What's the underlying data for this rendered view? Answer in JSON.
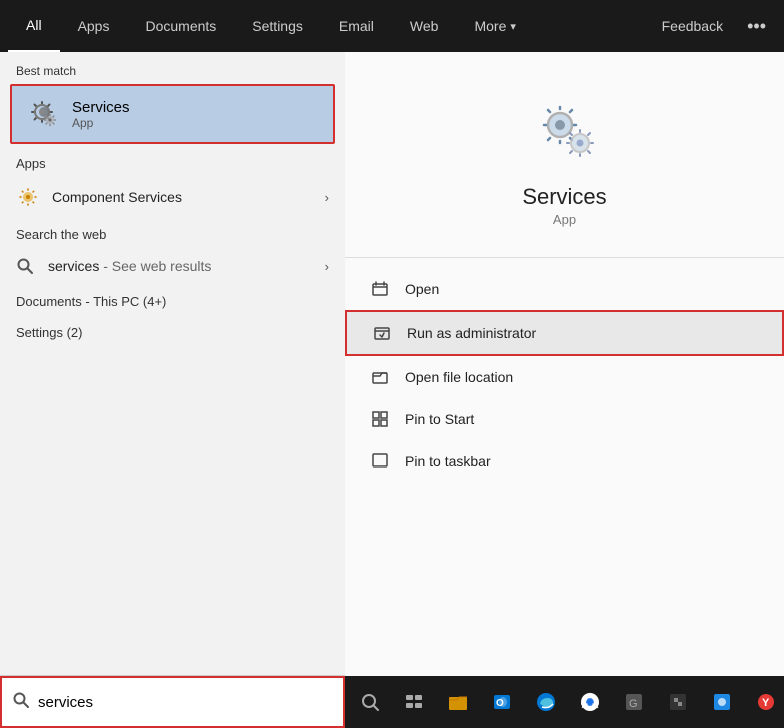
{
  "nav": {
    "tabs": [
      {
        "id": "all",
        "label": "All",
        "active": true
      },
      {
        "id": "apps",
        "label": "Apps",
        "active": false
      },
      {
        "id": "documents",
        "label": "Documents",
        "active": false
      },
      {
        "id": "settings",
        "label": "Settings",
        "active": false
      },
      {
        "id": "email",
        "label": "Email",
        "active": false
      },
      {
        "id": "web",
        "label": "Web",
        "active": false
      },
      {
        "id": "more",
        "label": "More",
        "active": false
      }
    ],
    "feedback_label": "Feedback",
    "more_icon": "•••"
  },
  "left": {
    "best_match_label": "Best match",
    "best_match_title": "Services",
    "best_match_sub": "App",
    "apps_label": "Apps",
    "apps_items": [
      {
        "label": "Component Services",
        "has_arrow": true
      }
    ],
    "web_label": "Search the web",
    "web_item_text": "services",
    "web_item_sub": " - See web results",
    "docs_label": "Documents - This PC (4+)",
    "settings_label": "Settings (2)"
  },
  "right": {
    "app_name": "Services",
    "app_type": "App",
    "actions": [
      {
        "label": "Open",
        "id": "open"
      },
      {
        "label": "Run as administrator",
        "id": "run-admin",
        "highlighted": true
      },
      {
        "label": "Open file location",
        "id": "open-file"
      },
      {
        "label": "Pin to Start",
        "id": "pin-start"
      },
      {
        "label": "Pin to taskbar",
        "id": "pin-taskbar"
      }
    ]
  },
  "search": {
    "value": "services",
    "placeholder": "services"
  }
}
